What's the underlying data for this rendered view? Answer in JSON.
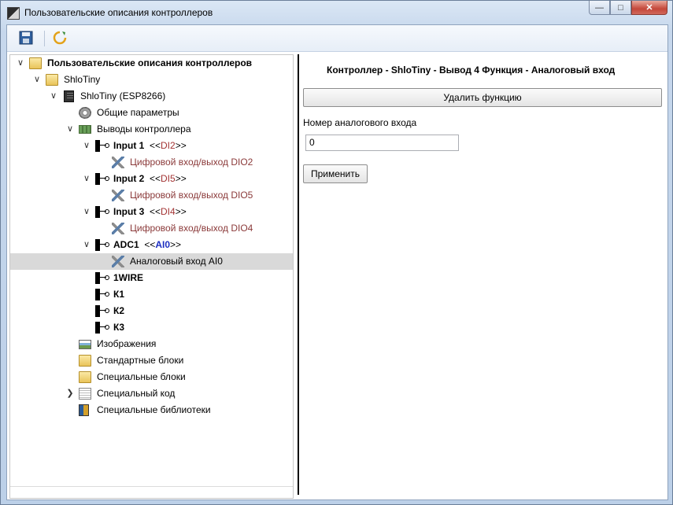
{
  "window": {
    "title": "Пользовательские описания контроллеров"
  },
  "tree": {
    "root": "Пользовательские описания контроллеров",
    "project": "ShloTiny",
    "controller": "ShloTiny (ESP8266)",
    "general_params": "Общие параметры",
    "pins_group": "Выводы контроллера",
    "pins": [
      {
        "name": "Input 1",
        "alias_pre": "<<",
        "alias": "DI2",
        "alias_post": ">>",
        "function": "Цифровой вход/выход DIO2"
      },
      {
        "name": "Input 2",
        "alias_pre": "<<",
        "alias": "DI5",
        "alias_post": ">>",
        "function": "Цифровой вход/выход DIO5"
      },
      {
        "name": "Input 3",
        "alias_pre": "<<",
        "alias": "DI4",
        "alias_post": ">>",
        "function": "Цифровой вход/выход DIO4"
      },
      {
        "name": "ADC1",
        "alias_pre": "<<",
        "alias": "AI0",
        "alias_post": ">>",
        "function": "Аналоговый вход AI0"
      }
    ],
    "other_pins": [
      "1WIRE",
      "К1",
      "К2",
      "К3"
    ],
    "images": "Изображения",
    "std_blocks": "Стандартные блоки",
    "special_blocks": "Специальные блоки",
    "special_code": "Специальный код",
    "special_libs": "Специальные библиотеки"
  },
  "panel": {
    "title": "Контроллер - ShloTiny - Вывод 4   Функция - Аналоговый вход",
    "delete_button": "Удалить функцию",
    "field_label": "Номер аналогового входа",
    "field_value": "0",
    "apply_button": "Применить"
  },
  "colors": {
    "selection": "#d9d9d9",
    "function_text": "#8b3a3a",
    "alias_blue": "#1d2fc1"
  }
}
